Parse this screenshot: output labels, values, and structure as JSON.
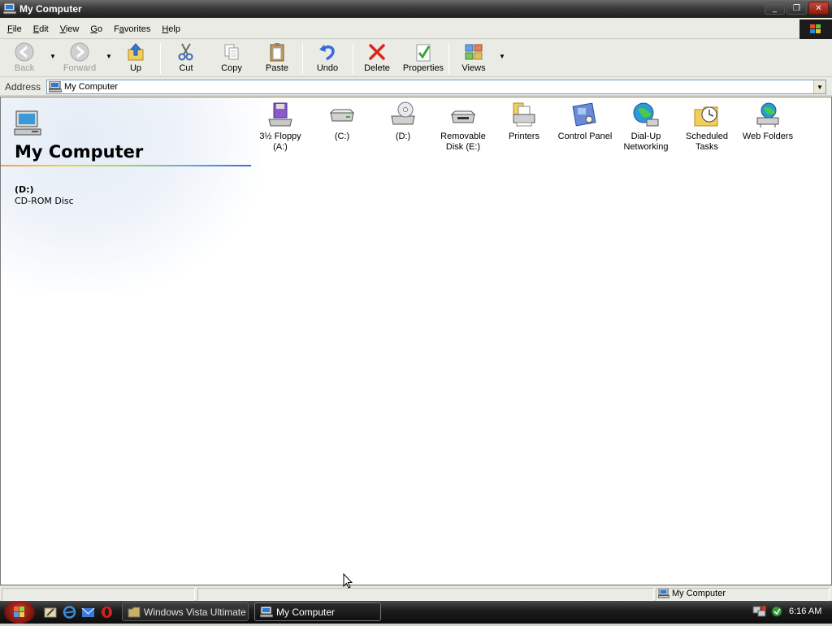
{
  "window": {
    "title": "My Computer",
    "controls": {
      "minimize": "_",
      "restore": "❐",
      "close": "✕"
    }
  },
  "menu": [
    {
      "label": "File",
      "underline": "F",
      "rest": "ile"
    },
    {
      "label": "Edit",
      "underline": "E",
      "rest": "dit"
    },
    {
      "label": "View",
      "underline": "V",
      "rest": "iew"
    },
    {
      "label": "Go",
      "underline": "G",
      "rest": "o"
    },
    {
      "label": "Favorites",
      "underline": "a",
      "pre": "F",
      "rest": "vorites"
    },
    {
      "label": "Help",
      "underline": "H",
      "rest": "elp"
    }
  ],
  "toolbar": {
    "back": "Back",
    "forward": "Forward",
    "up": "Up",
    "cut": "Cut",
    "copy": "Copy",
    "paste": "Paste",
    "undo": "Undo",
    "delete": "Delete",
    "properties": "Properties",
    "views": "Views"
  },
  "address": {
    "label": "Address",
    "value": "My Computer"
  },
  "left_pane": {
    "folder_title": "My Computer",
    "selected_name": "(D:)",
    "selected_type": "CD-ROM Disc"
  },
  "items": [
    {
      "name": "3½ Floppy (A:)",
      "line1": "3½ Floppy",
      "line2": "(A:)",
      "icon": "floppy-drive-icon"
    },
    {
      "name": "(C:)",
      "line1": "(C:)",
      "line2": "",
      "icon": "hard-disk-icon"
    },
    {
      "name": "(D:)",
      "line1": "(D:)",
      "line2": "",
      "icon": "cd-drive-icon"
    },
    {
      "name": "Removable Disk (E:)",
      "line1": "Removable",
      "line2": "Disk (E:)",
      "icon": "removable-disk-icon"
    },
    {
      "name": "Printers",
      "line1": "Printers",
      "line2": "",
      "icon": "printers-icon"
    },
    {
      "name": "Control Panel",
      "line1": "Control Panel",
      "line2": "",
      "icon": "control-panel-icon"
    },
    {
      "name": "Dial-Up Networking",
      "line1": "Dial-Up",
      "line2": "Networking",
      "icon": "dialup-networking-icon"
    },
    {
      "name": "Scheduled Tasks",
      "line1": "Scheduled",
      "line2": "Tasks",
      "icon": "scheduled-tasks-icon"
    },
    {
      "name": "Web Folders",
      "line1": "Web Folders",
      "line2": "",
      "icon": "web-folders-icon"
    }
  ],
  "statusbar": {
    "location": "My Computer"
  },
  "taskbar": {
    "tasks": [
      {
        "label": "Windows Vista Ultimate ...",
        "active": false
      },
      {
        "label": "My Computer",
        "active": true
      }
    ],
    "clock": "6:16 AM"
  }
}
